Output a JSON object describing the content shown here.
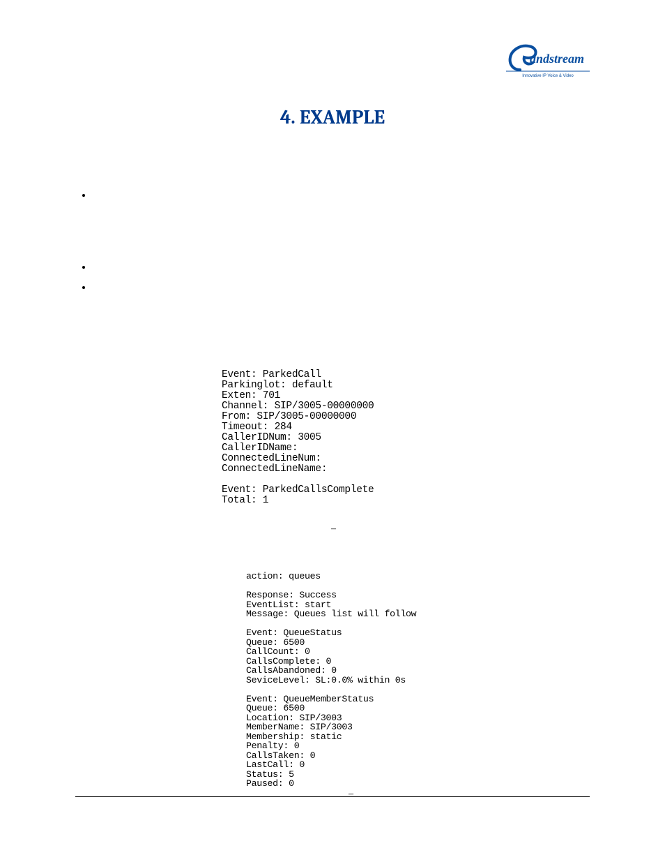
{
  "logo": {
    "brand_text": "andstream",
    "tagline": "Innovative IP Voice & Video"
  },
  "heading": "4. EXAMPLE",
  "bullets": [
    "",
    "",
    ""
  ],
  "code_block_1": "Event: ParkedCall\nParkinglot: default\nExten: 701\nChannel: SIP/3005-00000000\nFrom: SIP/3005-00000000\nTimeout: 284\nCallerIDNum: 3005\nCallerIDName:\nConnectedLineNum:\nConnectedLineName:\n\nEvent: ParkedCallsComplete\nTotal: 1",
  "dash1": "–",
  "code_block_2": "action: queues\n\nResponse: Success\nEventList: start\nMessage: Queues list will follow\n\nEvent: QueueStatus\nQueue: 6500\nCallCount: 0\nCallsComplete: 0\nCallsAbandoned: 0\nSeviceLevel: SL:0.0% within 0s\n\nEvent: QueueMemberStatus\nQueue: 6500\nLocation: SIP/3003\nMemberName: SIP/3003\nMembership: static\nPenalty: 0\nCallsTaken: 0\nLastCall: 0\nStatus: 5\nPaused: 0",
  "dash2": "–"
}
